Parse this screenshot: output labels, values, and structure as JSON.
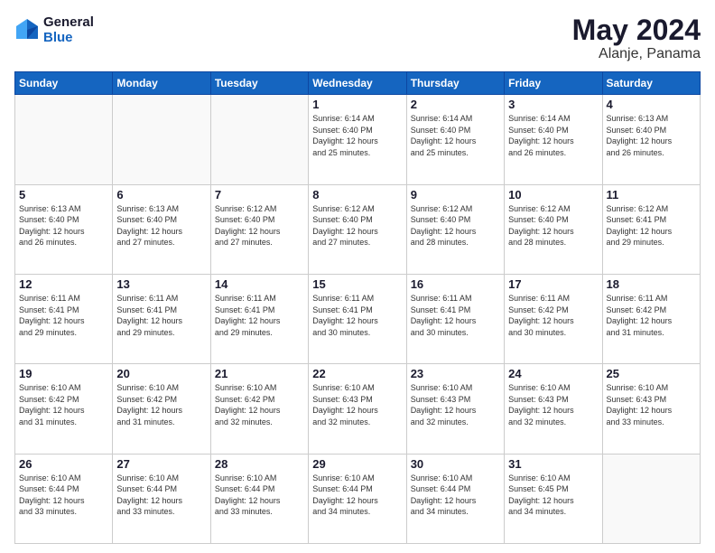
{
  "header": {
    "logo_line1": "General",
    "logo_line2": "Blue",
    "month": "May 2024",
    "location": "Alanje, Panama"
  },
  "weekdays": [
    "Sunday",
    "Monday",
    "Tuesday",
    "Wednesday",
    "Thursday",
    "Friday",
    "Saturday"
  ],
  "weeks": [
    [
      {
        "day": "",
        "sunrise": "",
        "sunset": "",
        "daylight": ""
      },
      {
        "day": "",
        "sunrise": "",
        "sunset": "",
        "daylight": ""
      },
      {
        "day": "",
        "sunrise": "",
        "sunset": "",
        "daylight": ""
      },
      {
        "day": "1",
        "sunrise": "Sunrise: 6:14 AM",
        "sunset": "Sunset: 6:40 PM",
        "daylight": "Daylight: 12 hours and 25 minutes."
      },
      {
        "day": "2",
        "sunrise": "Sunrise: 6:14 AM",
        "sunset": "Sunset: 6:40 PM",
        "daylight": "Daylight: 12 hours and 25 minutes."
      },
      {
        "day": "3",
        "sunrise": "Sunrise: 6:14 AM",
        "sunset": "Sunset: 6:40 PM",
        "daylight": "Daylight: 12 hours and 26 minutes."
      },
      {
        "day": "4",
        "sunrise": "Sunrise: 6:13 AM",
        "sunset": "Sunset: 6:40 PM",
        "daylight": "Daylight: 12 hours and 26 minutes."
      }
    ],
    [
      {
        "day": "5",
        "sunrise": "Sunrise: 6:13 AM",
        "sunset": "Sunset: 6:40 PM",
        "daylight": "Daylight: 12 hours and 26 minutes."
      },
      {
        "day": "6",
        "sunrise": "Sunrise: 6:13 AM",
        "sunset": "Sunset: 6:40 PM",
        "daylight": "Daylight: 12 hours and 27 minutes."
      },
      {
        "day": "7",
        "sunrise": "Sunrise: 6:12 AM",
        "sunset": "Sunset: 6:40 PM",
        "daylight": "Daylight: 12 hours and 27 minutes."
      },
      {
        "day": "8",
        "sunrise": "Sunrise: 6:12 AM",
        "sunset": "Sunset: 6:40 PM",
        "daylight": "Daylight: 12 hours and 27 minutes."
      },
      {
        "day": "9",
        "sunrise": "Sunrise: 6:12 AM",
        "sunset": "Sunset: 6:40 PM",
        "daylight": "Daylight: 12 hours and 28 minutes."
      },
      {
        "day": "10",
        "sunrise": "Sunrise: 6:12 AM",
        "sunset": "Sunset: 6:40 PM",
        "daylight": "Daylight: 12 hours and 28 minutes."
      },
      {
        "day": "11",
        "sunrise": "Sunrise: 6:12 AM",
        "sunset": "Sunset: 6:41 PM",
        "daylight": "Daylight: 12 hours and 29 minutes."
      }
    ],
    [
      {
        "day": "12",
        "sunrise": "Sunrise: 6:11 AM",
        "sunset": "Sunset: 6:41 PM",
        "daylight": "Daylight: 12 hours and 29 minutes."
      },
      {
        "day": "13",
        "sunrise": "Sunrise: 6:11 AM",
        "sunset": "Sunset: 6:41 PM",
        "daylight": "Daylight: 12 hours and 29 minutes."
      },
      {
        "day": "14",
        "sunrise": "Sunrise: 6:11 AM",
        "sunset": "Sunset: 6:41 PM",
        "daylight": "Daylight: 12 hours and 29 minutes."
      },
      {
        "day": "15",
        "sunrise": "Sunrise: 6:11 AM",
        "sunset": "Sunset: 6:41 PM",
        "daylight": "Daylight: 12 hours and 30 minutes."
      },
      {
        "day": "16",
        "sunrise": "Sunrise: 6:11 AM",
        "sunset": "Sunset: 6:41 PM",
        "daylight": "Daylight: 12 hours and 30 minutes."
      },
      {
        "day": "17",
        "sunrise": "Sunrise: 6:11 AM",
        "sunset": "Sunset: 6:42 PM",
        "daylight": "Daylight: 12 hours and 30 minutes."
      },
      {
        "day": "18",
        "sunrise": "Sunrise: 6:11 AM",
        "sunset": "Sunset: 6:42 PM",
        "daylight": "Daylight: 12 hours and 31 minutes."
      }
    ],
    [
      {
        "day": "19",
        "sunrise": "Sunrise: 6:10 AM",
        "sunset": "Sunset: 6:42 PM",
        "daylight": "Daylight: 12 hours and 31 minutes."
      },
      {
        "day": "20",
        "sunrise": "Sunrise: 6:10 AM",
        "sunset": "Sunset: 6:42 PM",
        "daylight": "Daylight: 12 hours and 31 minutes."
      },
      {
        "day": "21",
        "sunrise": "Sunrise: 6:10 AM",
        "sunset": "Sunset: 6:42 PM",
        "daylight": "Daylight: 12 hours and 32 minutes."
      },
      {
        "day": "22",
        "sunrise": "Sunrise: 6:10 AM",
        "sunset": "Sunset: 6:43 PM",
        "daylight": "Daylight: 12 hours and 32 minutes."
      },
      {
        "day": "23",
        "sunrise": "Sunrise: 6:10 AM",
        "sunset": "Sunset: 6:43 PM",
        "daylight": "Daylight: 12 hours and 32 minutes."
      },
      {
        "day": "24",
        "sunrise": "Sunrise: 6:10 AM",
        "sunset": "Sunset: 6:43 PM",
        "daylight": "Daylight: 12 hours and 32 minutes."
      },
      {
        "day": "25",
        "sunrise": "Sunrise: 6:10 AM",
        "sunset": "Sunset: 6:43 PM",
        "daylight": "Daylight: 12 hours and 33 minutes."
      }
    ],
    [
      {
        "day": "26",
        "sunrise": "Sunrise: 6:10 AM",
        "sunset": "Sunset: 6:44 PM",
        "daylight": "Daylight: 12 hours and 33 minutes."
      },
      {
        "day": "27",
        "sunrise": "Sunrise: 6:10 AM",
        "sunset": "Sunset: 6:44 PM",
        "daylight": "Daylight: 12 hours and 33 minutes."
      },
      {
        "day": "28",
        "sunrise": "Sunrise: 6:10 AM",
        "sunset": "Sunset: 6:44 PM",
        "daylight": "Daylight: 12 hours and 33 minutes."
      },
      {
        "day": "29",
        "sunrise": "Sunrise: 6:10 AM",
        "sunset": "Sunset: 6:44 PM",
        "daylight": "Daylight: 12 hours and 34 minutes."
      },
      {
        "day": "30",
        "sunrise": "Sunrise: 6:10 AM",
        "sunset": "Sunset: 6:44 PM",
        "daylight": "Daylight: 12 hours and 34 minutes."
      },
      {
        "day": "31",
        "sunrise": "Sunrise: 6:10 AM",
        "sunset": "Sunset: 6:45 PM",
        "daylight": "Daylight: 12 hours and 34 minutes."
      },
      {
        "day": "",
        "sunrise": "",
        "sunset": "",
        "daylight": ""
      }
    ]
  ]
}
